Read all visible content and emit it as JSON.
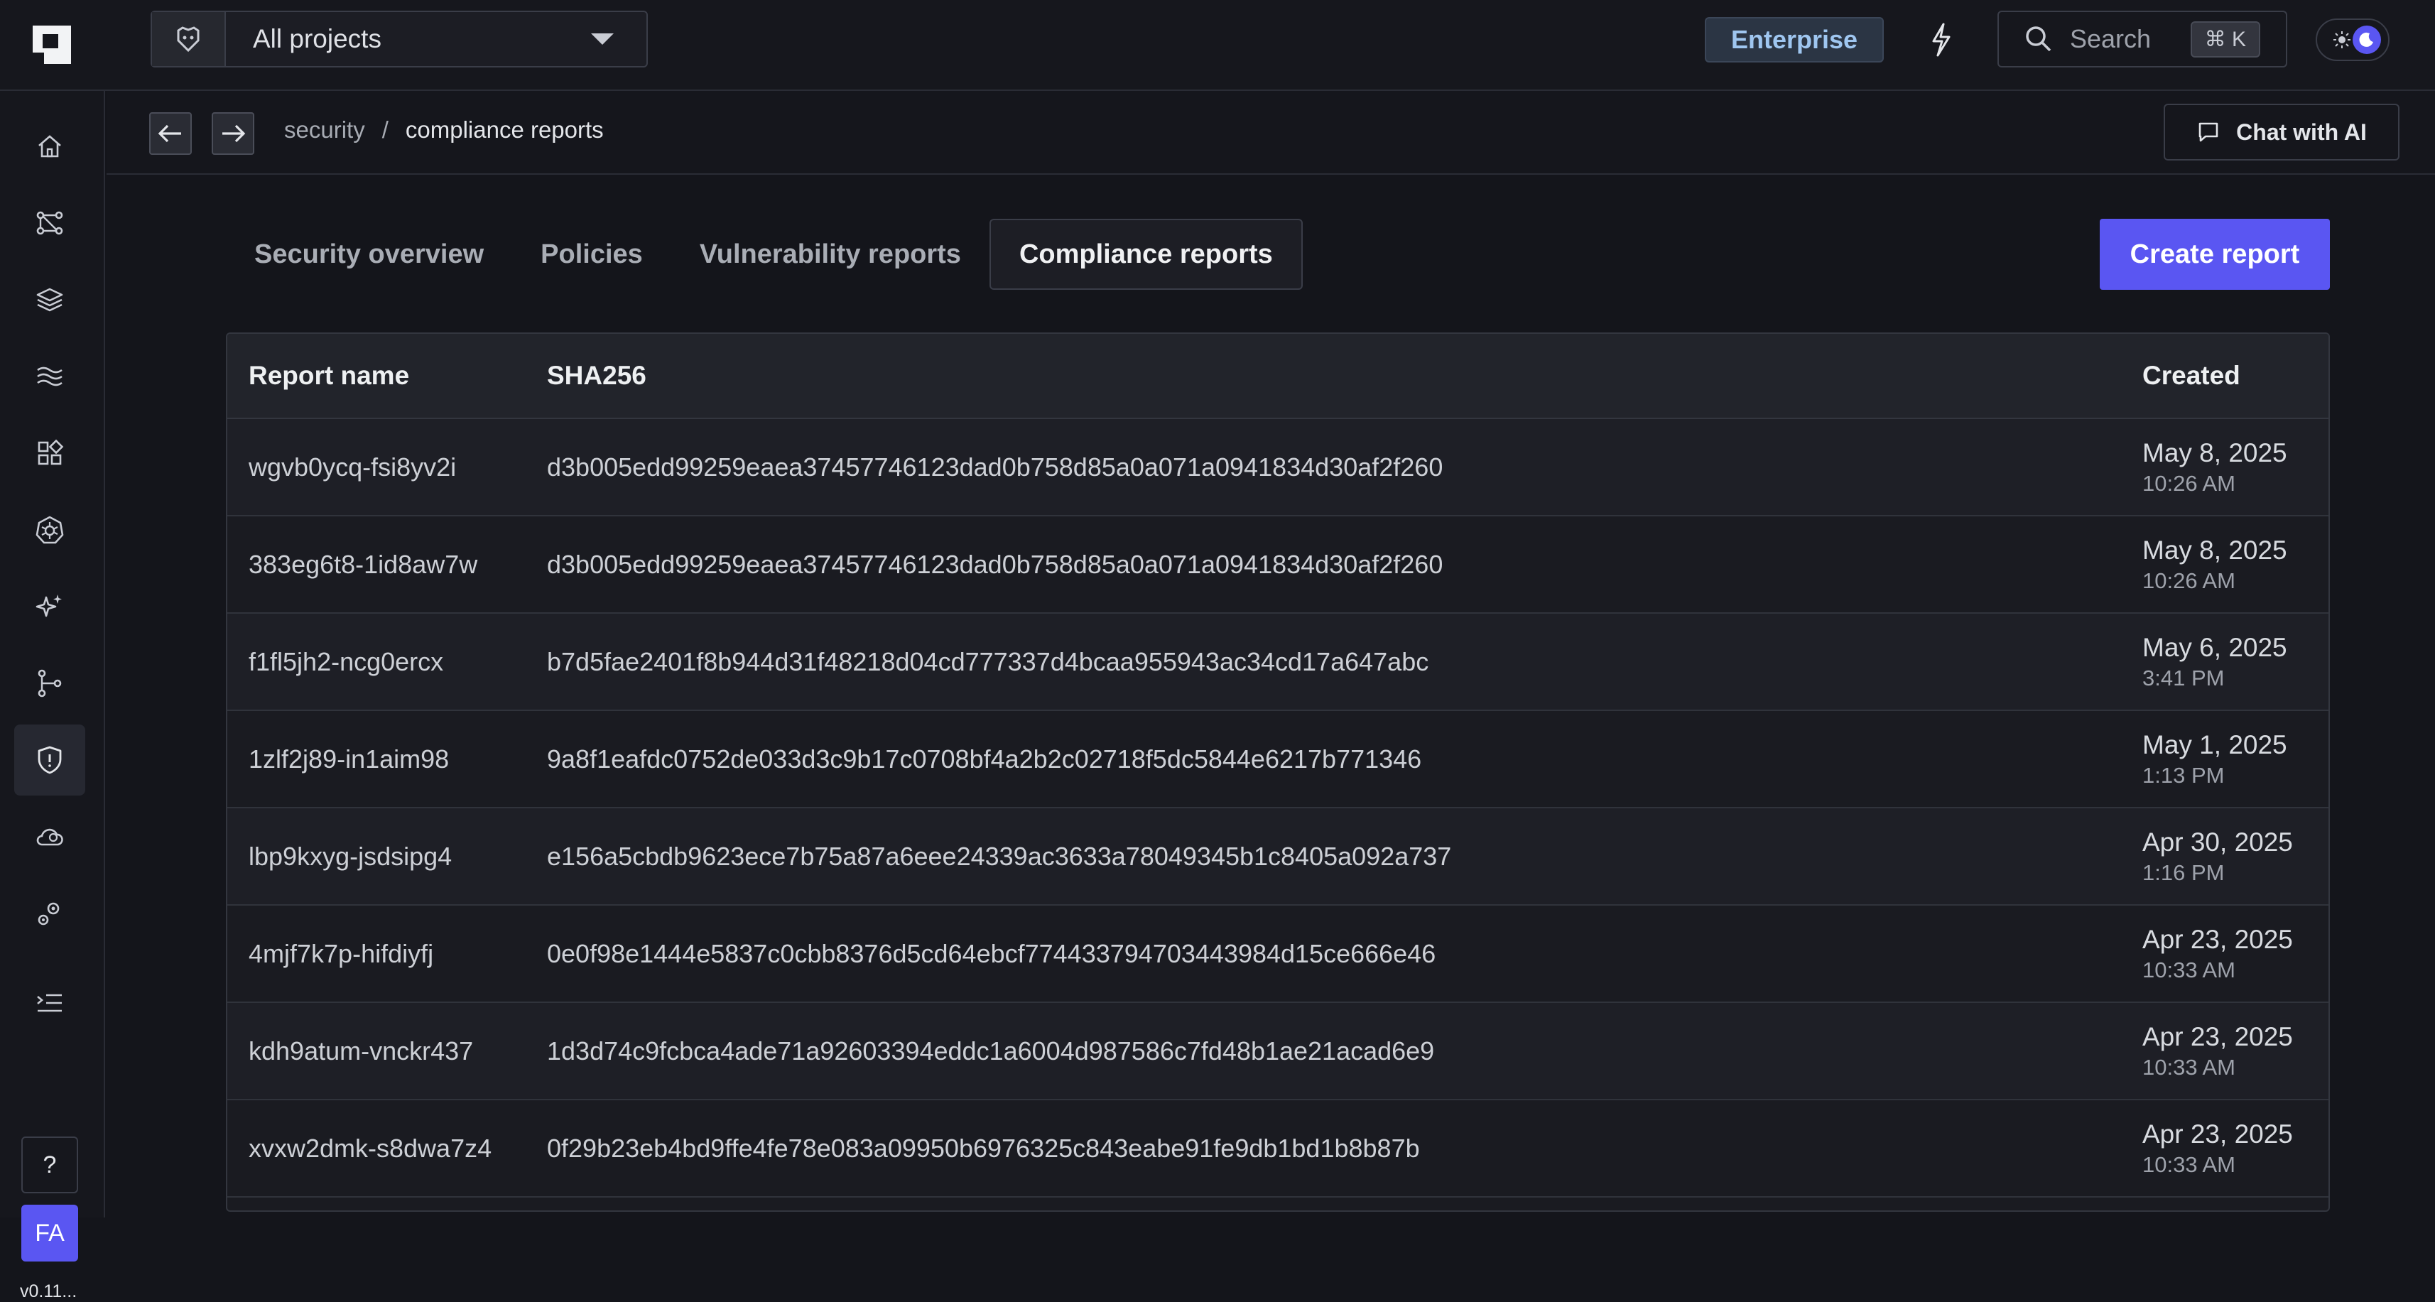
{
  "topbar": {
    "project_selector": "All projects",
    "enterprise_badge": "Enterprise",
    "search_placeholder": "Search",
    "search_shortcut": "⌘ K"
  },
  "sidebar": {
    "items": [
      "home-icon",
      "flow-icon",
      "layers-icon",
      "waves-icon",
      "catalog-icon",
      "kubernetes-icon",
      "ai-sparkles-icon",
      "pipeline-icon",
      "security-shield-icon",
      "cloud-cost-icon",
      "settings-gears-icon",
      "collapse-menu-icon"
    ],
    "active": "security-shield-icon",
    "help": "?",
    "avatar": "FA",
    "version": "v0.11..."
  },
  "breadcrumb": {
    "items": [
      "security",
      "compliance reports"
    ],
    "separator": "/",
    "chat_button": "Chat with AI"
  },
  "tabs": [
    {
      "label": "Security overview",
      "active": false
    },
    {
      "label": "Policies",
      "active": false
    },
    {
      "label": "Vulnerability reports",
      "active": false
    },
    {
      "label": "Compliance reports",
      "active": true
    }
  ],
  "create_button": "Create report",
  "table": {
    "headers": [
      "Report name",
      "SHA256",
      "Created"
    ],
    "rows": [
      {
        "name": "wgvb0ycq-fsi8yv2i",
        "sha": "d3b005edd99259eaea37457746123dad0b758d85a0a071a0941834d30af2f260",
        "date": "May 8, 2025",
        "time": "10:26 AM"
      },
      {
        "name": "383eg6t8-1id8aw7w",
        "sha": "d3b005edd99259eaea37457746123dad0b758d85a0a071a0941834d30af2f260",
        "date": "May 8, 2025",
        "time": "10:26 AM"
      },
      {
        "name": "f1fl5jh2-ncg0ercx",
        "sha": "b7d5fae2401f8b944d31f48218d04cd777337d4bcaa955943ac34cd17a647abc",
        "date": "May 6, 2025",
        "time": "3:41 PM"
      },
      {
        "name": "1zlf2j89-in1aim98",
        "sha": "9a8f1eafdc0752de033d3c9b17c0708bf4a2b2c02718f5dc5844e6217b771346",
        "date": "May 1, 2025",
        "time": "1:13 PM"
      },
      {
        "name": "lbp9kxyg-jsdsipg4",
        "sha": "e156a5cbdb9623ece7b75a87a6eee24339ac3633a78049345b1c8405a092a737",
        "date": "Apr 30, 2025",
        "time": "1:16 PM"
      },
      {
        "name": "4mjf7k7p-hifdiyfj",
        "sha": "0e0f98e1444e5837c0cbb8376d5cd64ebcf774433794703443984d15ce666e46",
        "date": "Apr 23, 2025",
        "time": "10:33 AM"
      },
      {
        "name": "kdh9atum-vnckr437",
        "sha": "1d3d74c9fcbca4ade71a92603394eddc1a6004d987586c7fd48b1ae21acad6e9",
        "date": "Apr 23, 2025",
        "time": "10:33 AM"
      },
      {
        "name": "xvxw2dmk-s8dwa7z4",
        "sha": "0f29b23eb4bd9ffe4fe78e083a09950b6976325c843eabe91fe9db1bd1b8b87b",
        "date": "Apr 23, 2025",
        "time": "10:33 AM"
      }
    ]
  }
}
